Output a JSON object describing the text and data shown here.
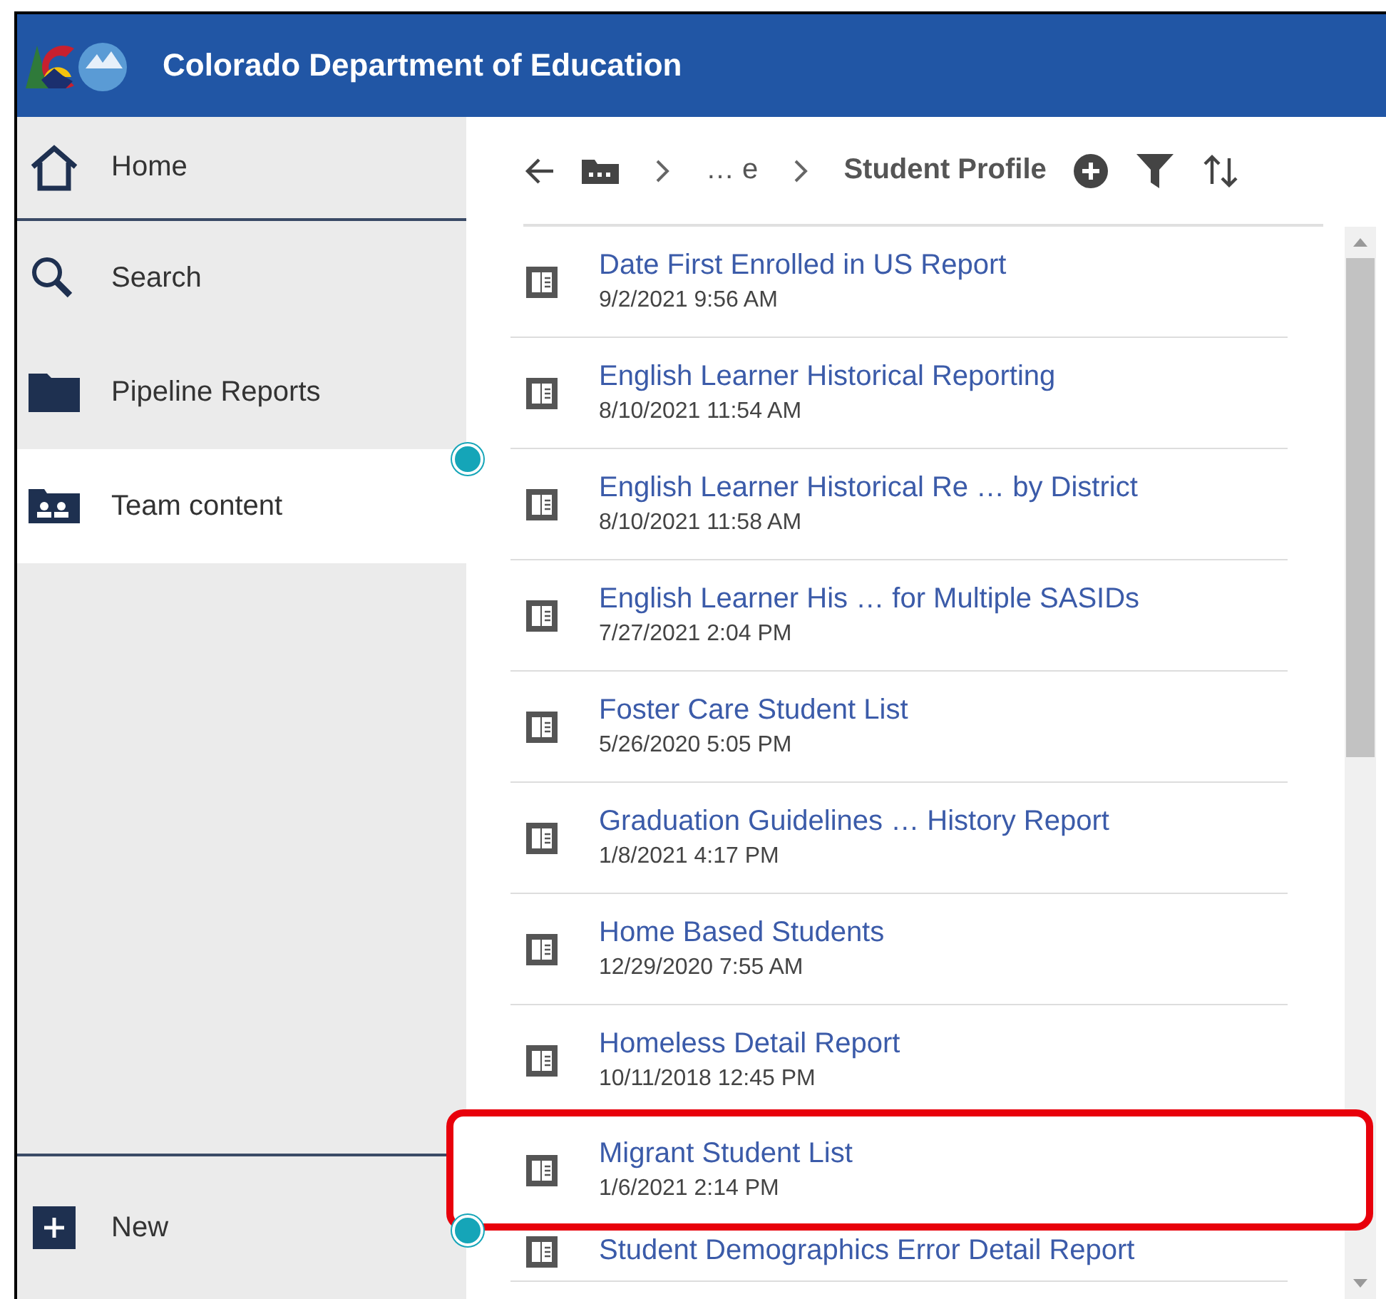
{
  "header": {
    "title": "Colorado Department of Education"
  },
  "sidebar": {
    "items": [
      {
        "label": "Home",
        "selected": false,
        "hotspot": false
      },
      {
        "label": "Search",
        "selected": false,
        "hotspot": false
      },
      {
        "label": "Pipeline Reports",
        "selected": false,
        "hotspot": false
      },
      {
        "label": "Team content",
        "selected": true,
        "hotspot": true
      }
    ],
    "new_button": {
      "label": "New",
      "hotspot": true
    }
  },
  "breadcrumb": {
    "middle": "… e",
    "current": "Student Profile"
  },
  "reports": [
    {
      "title": "Date First Enrolled in US Report",
      "date": "9/2/2021 9:56 AM",
      "highlighted": false
    },
    {
      "title": "English Learner Historical Reporting",
      "date": "8/10/2021 11:54 AM",
      "highlighted": false
    },
    {
      "title": "English Learner Historical Re … by District",
      "date": "8/10/2021 11:58 AM",
      "highlighted": false
    },
    {
      "title": "English Learner His … for Multiple SASIDs",
      "date": "7/27/2021 2:04 PM",
      "highlighted": false
    },
    {
      "title": "Foster Care Student List",
      "date": "5/26/2020 5:05 PM",
      "highlighted": false
    },
    {
      "title": "Graduation Guidelines … History Report",
      "date": "1/8/2021 4:17 PM",
      "highlighted": false
    },
    {
      "title": "Home Based Students",
      "date": "12/29/2020 7:55 AM",
      "highlighted": false
    },
    {
      "title": "Homeless Detail Report",
      "date": "10/11/2018 12:45 PM",
      "highlighted": false
    },
    {
      "title": "Migrant Student List",
      "date": "1/6/2021 2:14 PM",
      "highlighted": true
    },
    {
      "title": "Student Demographics Error Detail Report",
      "highlighted": false
    }
  ]
}
